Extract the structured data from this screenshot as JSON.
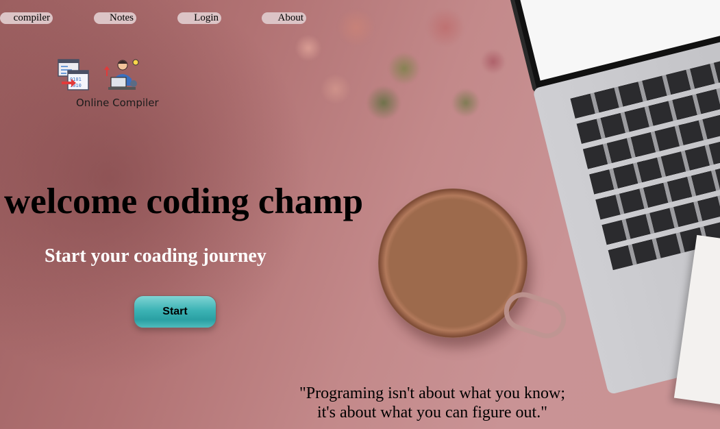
{
  "nav": {
    "items": [
      {
        "id": "compiler",
        "label": "compiler"
      },
      {
        "id": "notes",
        "label": "Notes"
      },
      {
        "id": "login",
        "label": "Login"
      },
      {
        "id": "about",
        "label": "About"
      }
    ]
  },
  "logo": {
    "text": "Online Compiler",
    "icons": [
      "code-conversion-icon",
      "developer-icon"
    ]
  },
  "hero": {
    "title": "welcome coding champ",
    "subtitle": "Start your coading journey",
    "start_label": "Start"
  },
  "quote": {
    "line1": "\"Programing isn't about what you know;",
    "line2": "it's about what you can figure out.\""
  },
  "colors": {
    "background": "#b47776",
    "nav_button": "#dcc4c6",
    "start_button": "#3cb3b5",
    "subtitle_text": "#ffffff"
  }
}
